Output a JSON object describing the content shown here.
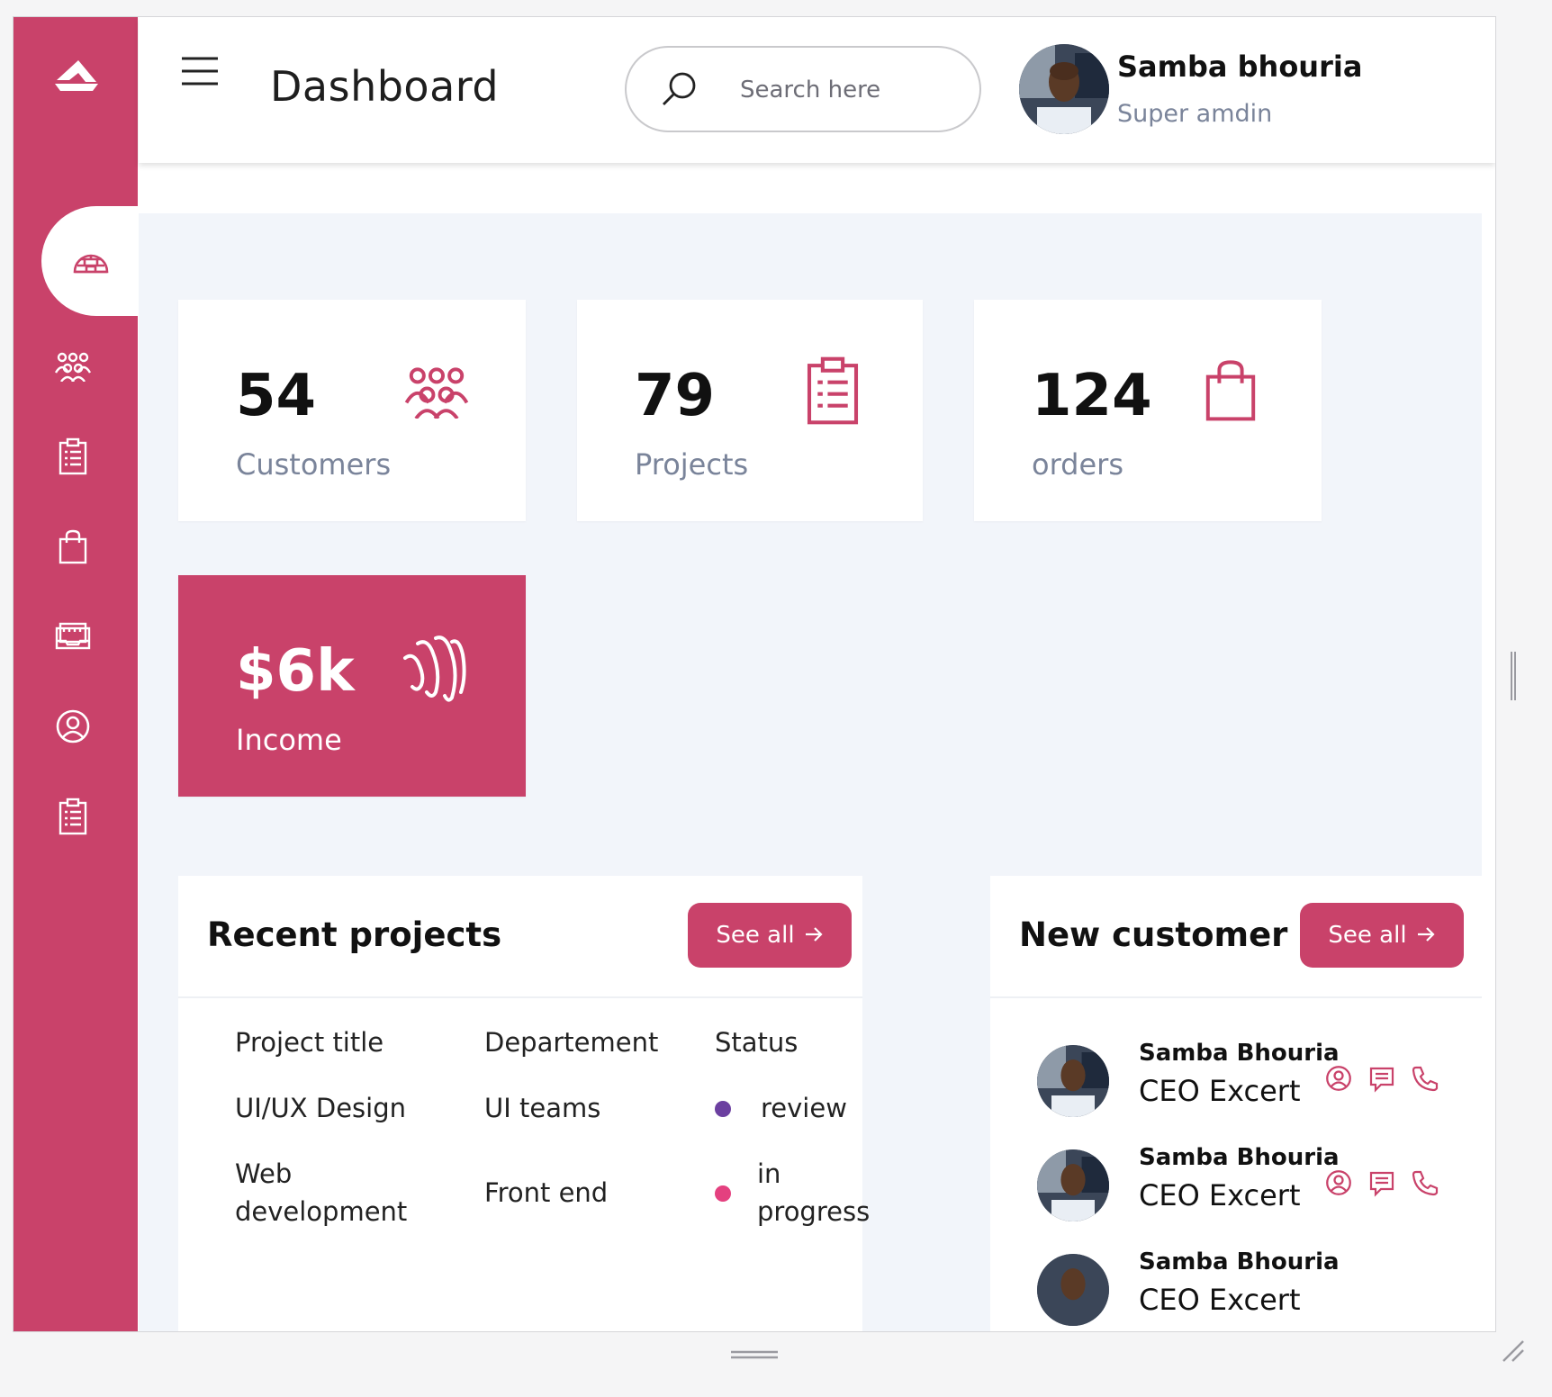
{
  "app": {
    "page_title": "Dashboard",
    "brand_color": "#c9426a"
  },
  "search": {
    "placeholder": "Search here",
    "value": ""
  },
  "profile": {
    "name": "Samba bhouria",
    "role": "Super amdin"
  },
  "sidebar": {
    "items": [
      {
        "icon": "dashboard-igloo-icon",
        "active": true
      },
      {
        "icon": "customers-icon",
        "active": false
      },
      {
        "icon": "clipboard-icon",
        "active": false
      },
      {
        "icon": "shopping-bag-icon",
        "active": false
      },
      {
        "icon": "inbox-icon",
        "active": false
      },
      {
        "icon": "user-circle-icon",
        "active": false
      },
      {
        "icon": "clipboard-icon",
        "active": false
      }
    ]
  },
  "stats": [
    {
      "value": "54",
      "label": "Customers",
      "icon": "customers-icon"
    },
    {
      "value": "79",
      "label": "Projects",
      "icon": "clipboard-icon"
    },
    {
      "value": "124",
      "label": "orders",
      "icon": "shopping-bag-icon"
    },
    {
      "value": "$6k",
      "label": "Income",
      "icon": "wallet-wave-icon"
    }
  ],
  "recent_projects": {
    "title": "Recent projects",
    "see_all": "See all",
    "columns": [
      "Project title",
      "Departement",
      "Status"
    ],
    "rows": [
      {
        "title": "UI/UX Design",
        "department": "UI teams",
        "status": "review",
        "status_color": "#6b3fa0"
      },
      {
        "title": "Web development",
        "department": "Front end",
        "status": "in progress",
        "status_color": "#e4407f"
      }
    ]
  },
  "new_customer": {
    "title": "New customer",
    "see_all": "See all",
    "items": [
      {
        "name": "Samba Bhouria",
        "role": "CEO Excert"
      },
      {
        "name": "Samba Bhouria",
        "role": "CEO Excert"
      },
      {
        "name": "Samba Bhouria",
        "role": "CEO Excert"
      }
    ]
  }
}
